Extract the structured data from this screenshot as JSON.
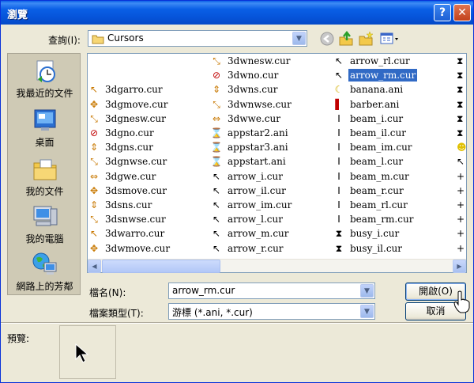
{
  "window": {
    "title": "瀏覽",
    "help_label": "?",
    "close_label": "✕"
  },
  "toolbar": {
    "lookin_label": "查詢(I):",
    "lookin_value": "Cursors",
    "icons": [
      "back-icon",
      "up-folder-icon",
      "new-folder-icon",
      "view-menu-icon"
    ]
  },
  "places": [
    {
      "label": "我最近的文件",
      "icon": "recent-documents-icon"
    },
    {
      "label": "桌面",
      "icon": "desktop-icon"
    },
    {
      "label": "我的文件",
      "icon": "my-documents-icon"
    },
    {
      "label": "我的電腦",
      "icon": "my-computer-icon"
    },
    {
      "label": "網路上的芳鄰",
      "icon": "network-places-icon"
    }
  ],
  "files": {
    "col1": [
      "",
      "",
      "3dgarro.cur",
      "3dgmove.cur",
      "3dgnesw.cur",
      "3dgno.cur",
      "3dgns.cur",
      "3dgnwse.cur",
      "3dgwe.cur",
      "3dsmove.cur",
      "3dsns.cur",
      "3dsnwse.cur",
      "3dwarro.cur",
      "3dwmove.cur"
    ],
    "col2": [
      "3dwnesw.cur",
      "3dwno.cur",
      "3dwns.cur",
      "3dwnwse.cur",
      "3dwwe.cur",
      "appstar2.ani",
      "appstar3.ani",
      "appstart.ani",
      "arrow_i.cur",
      "arrow_il.cur",
      "arrow_im.cur",
      "arrow_l.cur",
      "arrow_m.cur",
      "arrow_r.cur"
    ],
    "col3": [
      "arrow_rl.cur",
      "arrow_rm.cur",
      "banana.ani",
      "barber.ani",
      "beam_i.cur",
      "beam_il.cur",
      "beam_im.cur",
      "beam_l.cur",
      "beam_m.cur",
      "beam_r.cur",
      "beam_rl.cur",
      "beam_rm.cur",
      "busy_i.cur",
      "busy_il.cur"
    ],
    "selected": "arrow_rm.cur"
  },
  "filename": {
    "label": "檔名(N):",
    "value": "arrow_rm.cur"
  },
  "filetype": {
    "label": "檔案類型(T):",
    "value": "游標 (*.ani, *.cur)"
  },
  "buttons": {
    "open": "開啟(O)",
    "cancel": "取消"
  },
  "preview": {
    "label": "預覽:"
  },
  "colors": {
    "selection": "#316ac5",
    "title_bar": "#0a5fe6",
    "dialog_bg": "#ece9d8"
  }
}
